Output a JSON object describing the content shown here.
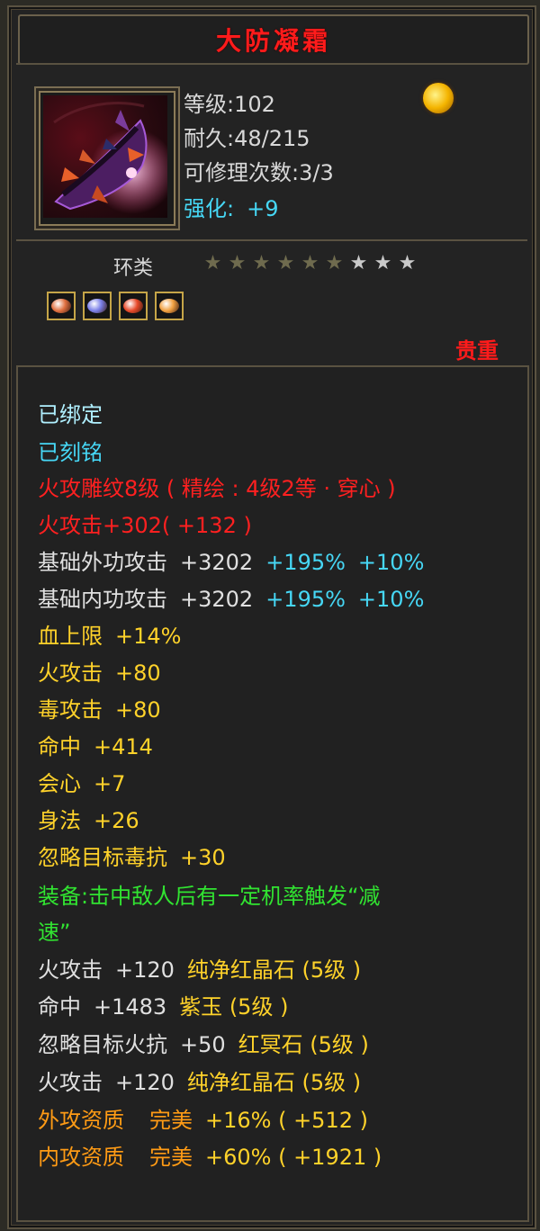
{
  "item": {
    "name": "大防凝霜",
    "stats": {
      "level_label": "等级",
      "level_value": ":102",
      "durability_label": "耐久",
      "durability_value": ":48/215",
      "repair_label": "可修理次数",
      "repair_value": ":3/3",
      "enhance_label": "强化:",
      "enhance_value": "+9"
    },
    "category": "环类",
    "stars_filled": 6,
    "stars_total": 9,
    "quality": "贵重",
    "gem_colors": [
      "#e07040",
      "#7a7fe8",
      "#e84a2a",
      "#f0a040"
    ]
  },
  "props": {
    "bound": "已绑定",
    "inscribed": "已刻铭",
    "engrave": "火攻雕纹8级 ( 精绘 : 4级2等 · 穿心 )",
    "fire_attack_main": "火攻击+302",
    "fire_attack_bonus": "( +132 )",
    "ext_label": "基础外功攻击",
    "ext_val": "+3202",
    "ext_pct1": "+195%",
    "ext_pct2": "+10%",
    "int_label": "基础内功攻击",
    "int_val": "+3202",
    "int_pct1": "+195%",
    "int_pct2": "+10%",
    "hp": "血上限",
    "hp_val": "+14%",
    "fire": "火攻击",
    "fire_val": "+80",
    "poison": "毒攻击",
    "poison_val": "+80",
    "hit": "命中",
    "hit_val": "+414",
    "crit": "会心",
    "crit_val": "+7",
    "agility": "身法",
    "agility_val": "+26",
    "ignore_poison": "忽略目标毒抗",
    "ignore_poison_val": "+30",
    "equip_effect_1": "装备:击中敌人后有一定机率触发“减",
    "equip_effect_2": "速”",
    "gem1": "火攻击",
    "gem1_val": "+120",
    "gem1_name": "纯净红晶石 (5级 )",
    "gem2": "命中",
    "gem2_val": "+1483",
    "gem2_name": "紫玉 (5级 )",
    "gem3": "忽略目标火抗",
    "gem3_val": "+50",
    "gem3_name": "红冥石 (5级 )",
    "gem4": "火攻击",
    "gem4_val": "+120",
    "gem4_name": "纯净红晶石 (5级 )",
    "ext_quality_label": "外攻资质",
    "ext_quality_grade": "完美",
    "ext_quality_val": "+16% ( +512 )",
    "int_quality_label": "内攻资质",
    "int_quality_grade": "完美",
    "int_quality_val": "+60% ( +1921 )"
  },
  "colors": {
    "title": "#ff1b1b",
    "bound": "#b0f0ff",
    "inscribed": "#46d7f5",
    "red": "#ff2020",
    "yellow": "#ffd22a",
    "green": "#31e331",
    "orange": "#ff9b15",
    "star_on": "#6f6b4e",
    "star_off": "#c9c9c9"
  }
}
